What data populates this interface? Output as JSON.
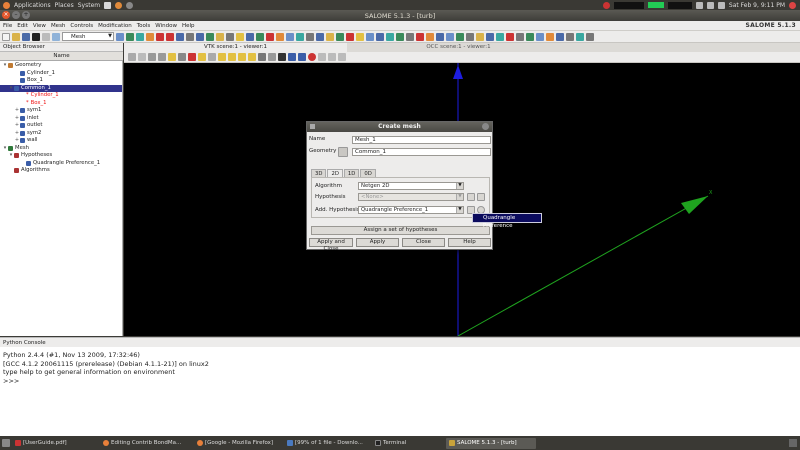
{
  "gnome_panel": {
    "menus": [
      "Applications",
      "Places",
      "System"
    ],
    "clock": "Sat Feb 9, 9:11 PM"
  },
  "window": {
    "title": "SALOME 5.1.3 - [turb]",
    "brand": "SALOME 5.1.3"
  },
  "menubar": [
    "File",
    "Edit",
    "View",
    "Mesh",
    "Controls",
    "Modification",
    "Tools",
    "Window",
    "Help"
  ],
  "toolbar": {
    "module": "Mesh"
  },
  "object_browser": {
    "label": "Object Browser",
    "header": "Name",
    "items": [
      {
        "text": "Geometry",
        "indent": 0,
        "toggle": "−",
        "icon": "#c07a32"
      },
      {
        "text": "Cylinder_1",
        "indent": 2,
        "toggle": "",
        "icon": "#3a5da8"
      },
      {
        "text": "Box_1",
        "indent": 2,
        "toggle": "",
        "icon": "#3a5da8"
      },
      {
        "text": "Common_1",
        "indent": 1,
        "toggle": "−",
        "icon": "#3a5da8",
        "selected": true
      },
      {
        "text": "Cylinder_1",
        "indent": 3,
        "toggle": "",
        "icon": "",
        "red": true
      },
      {
        "text": "Box_1",
        "indent": 3,
        "toggle": "",
        "icon": "",
        "red": true
      },
      {
        "text": "sym1",
        "indent": 2,
        "toggle": "+",
        "icon": "#3a5da8"
      },
      {
        "text": "inlet",
        "indent": 2,
        "toggle": "+",
        "icon": "#3a5da8"
      },
      {
        "text": "outlet",
        "indent": 2,
        "toggle": "+",
        "icon": "#3a5da8"
      },
      {
        "text": "sym2",
        "indent": 2,
        "toggle": "+",
        "icon": "#3a5da8"
      },
      {
        "text": "wall",
        "indent": 2,
        "toggle": "+",
        "icon": "#3a5da8"
      },
      {
        "text": "Mesh",
        "indent": 0,
        "toggle": "−",
        "icon": "#2f7a3a"
      },
      {
        "text": "Hypotheses",
        "indent": 1,
        "toggle": "−",
        "icon": "#a33"
      },
      {
        "text": "Quadrangle Preference_1",
        "indent": 3,
        "toggle": "",
        "icon": "#3a5da8"
      },
      {
        "text": "Algorithms",
        "indent": 1,
        "toggle": "",
        "icon": "#a33"
      }
    ]
  },
  "viewer_tabs": [
    {
      "label": "VTK scene:1 - viewer:1",
      "active": true
    },
    {
      "label": "OCC scene:1 - viewer:1",
      "active": false
    }
  ],
  "python_console": {
    "label": "Python Console",
    "lines": [
      "Python 2.4.4 (#1, Nov 13 2009, 17:32:46)",
      "[GCC 4.1.2 20061115 (prerelease) (Debian 4.1.1-21)] on linux2",
      "type help to get general information on environment",
      ">>>"
    ]
  },
  "dialog": {
    "title": "Create mesh",
    "name_label": "Name",
    "name_value": "Mesh_1",
    "geometry_label": "Geometry",
    "geometry_value": "Common_1",
    "tabs": [
      "3D",
      "2D",
      "1D",
      "0D"
    ],
    "active_tab": "2D",
    "algorithm_label": "Algorithm",
    "algorithm_value": "Netgen 2D",
    "hypothesis_label": "Hypothesis",
    "hypothesis_value": "<None>",
    "add_hypothesis_label": "Add. Hypothesis",
    "add_hypothesis_value": "Quadrangle Preference_1",
    "assign_label": "Assign a set of hypotheses",
    "buttons": {
      "apply_close": "Apply and Close",
      "apply": "Apply",
      "close": "Close",
      "help": "Help"
    }
  },
  "tooltip": "Quadrangle Preference",
  "taskbar": [
    {
      "label": "[UserGuide.pdf]",
      "color": "#c33"
    },
    {
      "label": "Editing Contrib BondMa...",
      "color": "#e8803a"
    },
    {
      "label": "[Google - Mozilla Firefox]",
      "color": "#e8803a"
    },
    {
      "label": "[99% of 1 file - Downlo...",
      "color": "#4a7ac0"
    },
    {
      "label": "Terminal",
      "color": "#333"
    },
    {
      "label": "SALOME 5.1.3 - [turb]",
      "color": "#c9a33a",
      "active": true
    }
  ]
}
